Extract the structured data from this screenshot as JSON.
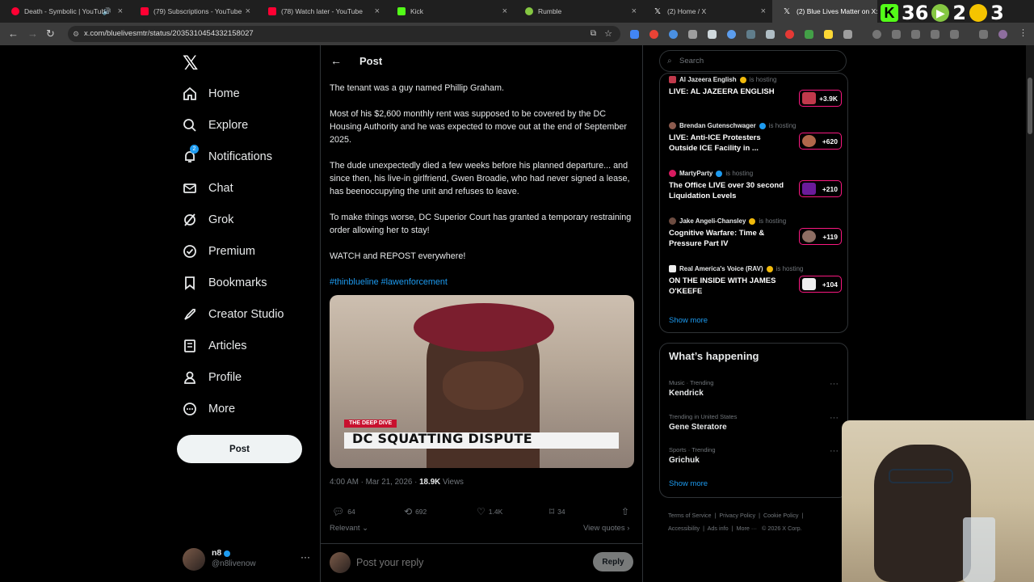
{
  "browser": {
    "tabs": [
      {
        "title": "Death - Symbolic | YouTube",
        "color": "#ff0033"
      },
      {
        "title": "(79) Subscriptions - YouTube",
        "color": "#ff0033"
      },
      {
        "title": "(78) Watch later - YouTube",
        "color": "#ff0033"
      },
      {
        "title": "Kick",
        "color": "#53fc18"
      },
      {
        "title": "Rumble",
        "color": "#85c742"
      },
      {
        "title": "(2) Home / X",
        "color": "#ffffff"
      },
      {
        "title": "(2) Blue Lives Matter on X:",
        "color": "#ffffff"
      }
    ],
    "url": "x.com/bluelivesmtr/status/2035310454332158027",
    "overlay": {
      "kick_count": "36",
      "rumble_count": "2",
      "third_count": "3"
    }
  },
  "leftnav": {
    "items": [
      {
        "label": "Home",
        "icon": "home-icon"
      },
      {
        "label": "Explore",
        "icon": "search-icon"
      },
      {
        "label": "Notifications",
        "icon": "bell-icon",
        "badge": "2"
      },
      {
        "label": "Chat",
        "icon": "mail-icon"
      },
      {
        "label": "Grok",
        "icon": "grok-icon"
      },
      {
        "label": "Premium",
        "icon": "verified-icon"
      },
      {
        "label": "Bookmarks",
        "icon": "bookmark-icon"
      },
      {
        "label": "Creator Studio",
        "icon": "rocket-icon"
      },
      {
        "label": "Articles",
        "icon": "article-icon"
      },
      {
        "label": "Profile",
        "icon": "person-icon"
      },
      {
        "label": "More",
        "icon": "more-circle-icon"
      }
    ],
    "post_button": "Post",
    "account": {
      "name": "n8",
      "handle": "@n8livenow"
    }
  },
  "post": {
    "header": "Post",
    "paragraphs": [
      "The tenant was a guy named Phillip Graham.",
      "Most of his $2,600 monthly rent was supposed to be covered by the DC Housing Authority and he was expected to move out at the end of September 2025.",
      "The dude unexpectedly died a few weeks before his planned departure... and since then, his live-in girlfriend, Gwen Broadie, who had never signed a lease, has beenoccupying the unit and refuses to leave.",
      "To make things worse, DC Superior Court has granted a temporary restraining order allowing her to stay!",
      "WATCH and REPOST everywhere!"
    ],
    "hashtags": "#thinblueline #lawenforcement",
    "media": {
      "tag": "THE DEEP DIVE",
      "headline": "DC SQUATTING DISPUTE"
    },
    "timestamp": "4:00 AM · Mar 21, 2026 ·",
    "views_count": "18.9K",
    "views_label": "Views",
    "stats": {
      "replies": "64",
      "reposts": "692",
      "likes": "1.4K",
      "bookmarks": "34"
    },
    "relevant": "Relevant",
    "view_quotes": "View quotes",
    "reply_placeholder": "Post your reply",
    "reply_button": "Reply"
  },
  "sidebar": {
    "search_placeholder": "Search",
    "live": [
      {
        "host": "Al Jazeera English",
        "status": "is hosting",
        "title": "LIVE: AL JAZEERA ENGLISH",
        "count": "+3.9K",
        "thumb": "#c0394b"
      },
      {
        "host": "Brendan Gutenschwager",
        "status": "is hosting",
        "title": "LIVE: Anti-ICE Protesters Outside ICE Facility in ...",
        "count": "+620",
        "thumb": "#b0674a"
      },
      {
        "host": "MartyParty",
        "status": "is hosting",
        "title": "The Office LIVE over 30 second Liquidation Levels",
        "count": "+210",
        "thumb": "#6a1b9a"
      },
      {
        "host": "Jake Angeli-Chansley",
        "status": "is hosting",
        "title": "Cognitive Warfare: Time & Pressure Part IV",
        "count": "+119",
        "thumb": "#8d6e63"
      },
      {
        "host": "Real America's Voice (RAV)",
        "status": "is hosting",
        "title": "ON THE INSIDE WITH JAMES O'KEEFE",
        "count": "+104",
        "thumb": "#eeeeee"
      }
    ],
    "live_show_more": "Show more",
    "happening_title": "What’s happening",
    "trends": [
      {
        "category": "Music · Trending",
        "name": "Kendrick"
      },
      {
        "category": "Trending in United States",
        "name": "Gene Steratore"
      },
      {
        "category": "Sports · Trending",
        "name": "Grichuk"
      }
    ],
    "trends_show_more": "Show more",
    "footer": {
      "terms": "Terms of Service",
      "privacy": "Privacy Policy",
      "cookie": "Cookie Policy",
      "accessibility": "Accessibility",
      "ads": "Ads info",
      "more": "More ···",
      "copyright": "© 2026 X Corp."
    }
  },
  "colors": {
    "accent": "#1d9bf0",
    "live": "#f91880",
    "bg": "#000000"
  }
}
